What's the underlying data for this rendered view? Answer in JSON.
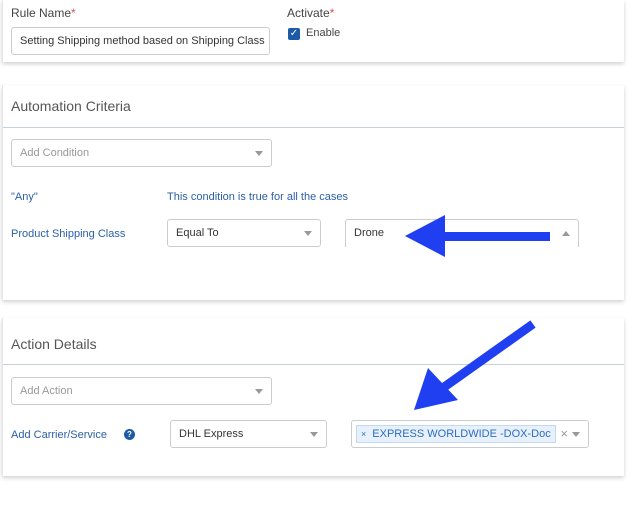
{
  "rule": {
    "name_label": "Rule Name",
    "name_value": "Setting Shipping method based on Shipping Class",
    "activate_label": "Activate",
    "enable_label": "Enable",
    "enabled": true
  },
  "criteria": {
    "title": "Automation Criteria",
    "add_condition_placeholder": "Add Condition",
    "any_label": "\"Any\"",
    "any_desc": "This condition is true for all the cases",
    "field_label": "Product Shipping Class",
    "operator": "Equal To",
    "value": "Drone"
  },
  "action": {
    "title": "Action Details",
    "add_action_placeholder": "Add Action",
    "field_label": "Add Carrier/Service",
    "carrier": "DHL Express",
    "service_tag": "EXPRESS WORLDWIDE -DOX-Doc"
  },
  "annotations": {
    "arrow_color": "#1f3ff0"
  }
}
